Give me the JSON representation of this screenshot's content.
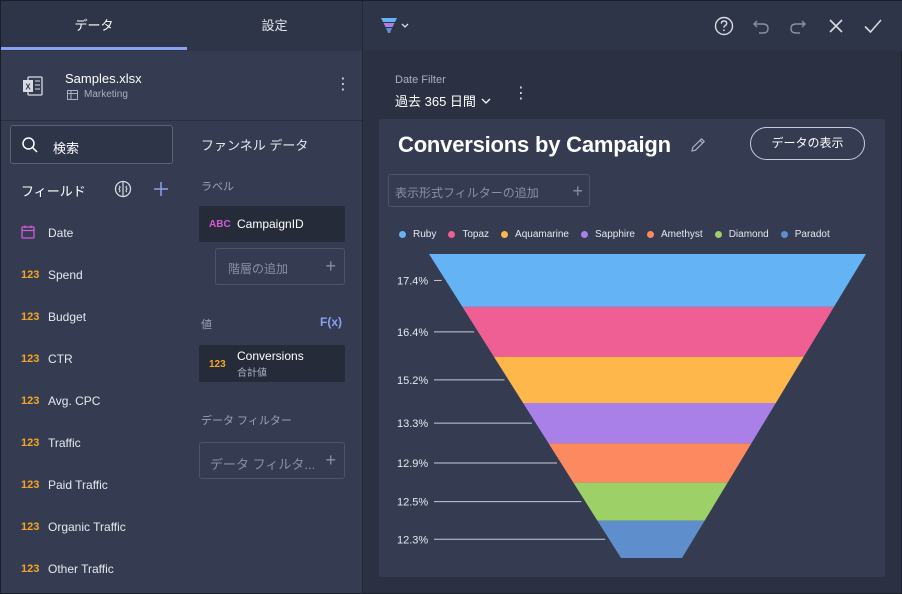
{
  "tabs": {
    "data": "データ",
    "settings": "設定"
  },
  "source": {
    "file": "Samples.xlsx",
    "sheet": "Marketing"
  },
  "search": {
    "label": "検索"
  },
  "fields": {
    "header": "フィールド",
    "items": [
      {
        "type": "date",
        "name": "Date"
      },
      {
        "type": "123",
        "name": "Spend"
      },
      {
        "type": "123",
        "name": "Budget"
      },
      {
        "type": "123",
        "name": "CTR"
      },
      {
        "type": "123",
        "name": "Avg. CPC"
      },
      {
        "type": "123",
        "name": "Traffic"
      },
      {
        "type": "123",
        "name": "Paid Traffic"
      },
      {
        "type": "123",
        "name": "Organic Traffic"
      },
      {
        "type": "123",
        "name": "Other Traffic"
      }
    ]
  },
  "funnel_data": {
    "title": "ファンネル データ",
    "label_section": "ラベル",
    "label_field": {
      "type": "ABC",
      "name": "CampaignID"
    },
    "add_hierarchy": "階層の追加",
    "value_section": "値",
    "fx_label": "F(x)",
    "value_field": {
      "type": "123",
      "name": "Conversions",
      "agg": "合計値"
    },
    "filter_section": "データ フィルター",
    "filter_placeholder": "データ フィルタ..."
  },
  "date_filter": {
    "label": "Date Filter",
    "value": "過去 365 日間"
  },
  "card": {
    "title": "Conversions by Campaign",
    "view_data_button": "データの表示",
    "vis_filter": "表示形式フィルターの追加"
  },
  "colors": {
    "accent": "#8aa0f0",
    "orange": "#f5a623",
    "abc": "#d35bd6"
  },
  "chart_data": {
    "type": "funnel",
    "series": [
      {
        "name": "Ruby",
        "value": 17.4,
        "color": "#63b3f5"
      },
      {
        "name": "Topaz",
        "value": 16.4,
        "color": "#ef5f94"
      },
      {
        "name": "Aquamarine",
        "value": 15.2,
        "color": "#fdb74b"
      },
      {
        "name": "Sapphire",
        "value": 13.3,
        "color": "#a97fe8"
      },
      {
        "name": "Amethyst",
        "value": 12.9,
        "color": "#fd8961"
      },
      {
        "name": "Diamond",
        "value": 12.5,
        "color": "#9dd067"
      },
      {
        "name": "Paradot",
        "value": 12.3,
        "color": "#5e8ecb"
      }
    ],
    "value_suffix": "%",
    "legend_position": "top"
  }
}
